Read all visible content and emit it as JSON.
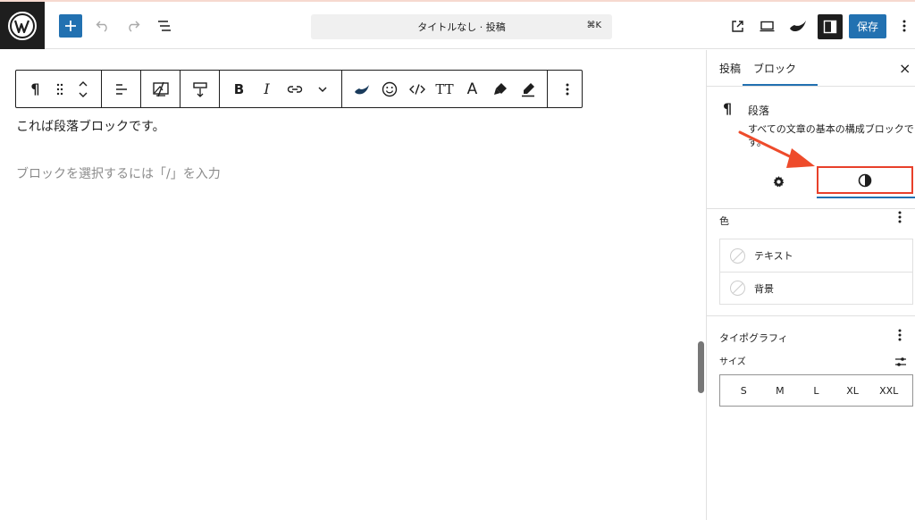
{
  "header": {
    "title": "タイトルなし · 投稿",
    "shortcut": "⌘K",
    "save_label": "保存"
  },
  "editor": {
    "paragraph_text": "これば段落ブロックです。",
    "placeholder": "ブロックを選択するには「/」を入力"
  },
  "sidebar": {
    "tabs": [
      {
        "label": "投稿"
      },
      {
        "label": "ブロック"
      }
    ],
    "close_label": "×",
    "block_card": {
      "icon": "pilcrow-icon",
      "title": "段落",
      "description": "すべての文章の基本の構成ブロックです。"
    },
    "color_section": {
      "title": "色",
      "items": [
        {
          "label": "テキスト"
        },
        {
          "label": "背景"
        }
      ]
    },
    "typography_section": {
      "title": "タイポグラフィ",
      "size_label": "サイズ",
      "sizes": [
        "S",
        "M",
        "L",
        "XL",
        "XXL"
      ]
    }
  },
  "colors": {
    "accent": "#2271b1",
    "highlight_border": "#e8402a",
    "arrow": "#ee4b2b"
  }
}
